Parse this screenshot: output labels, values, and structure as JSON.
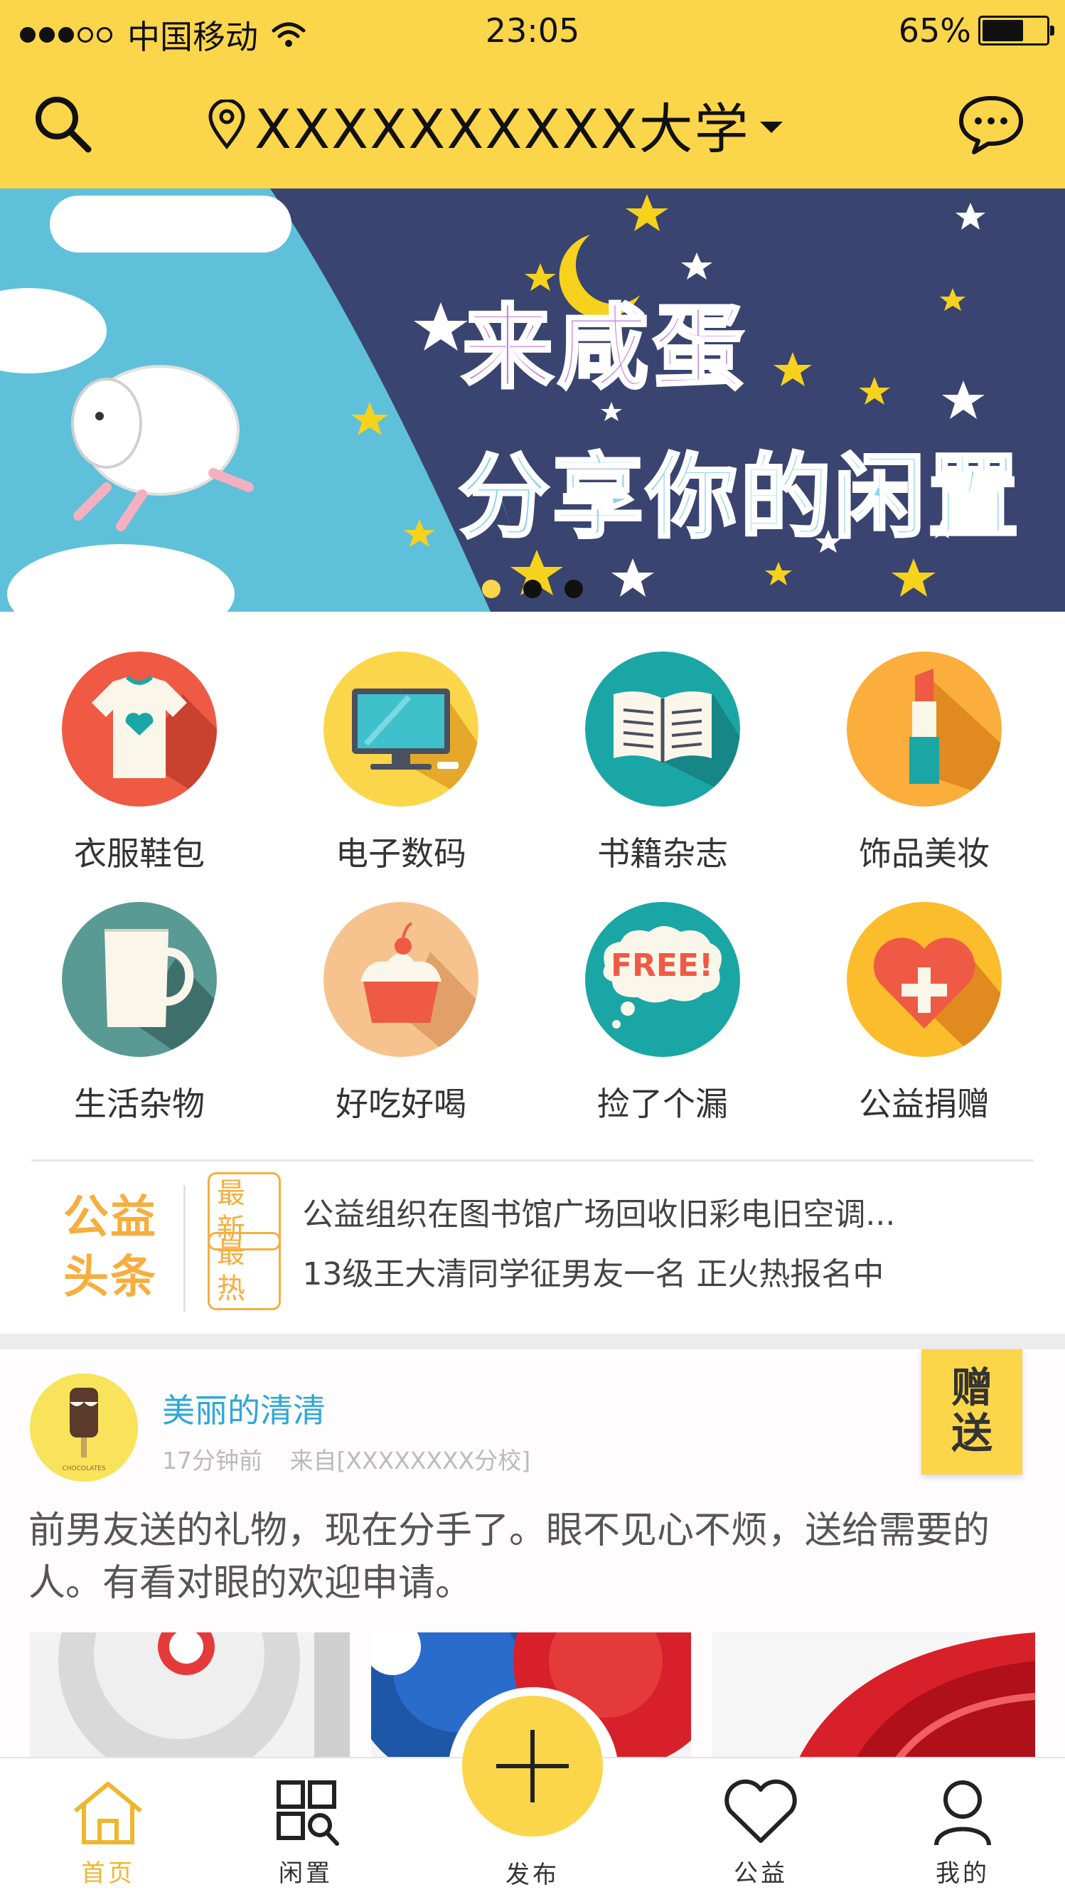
{
  "status_bar": {
    "carrier": "中国移动",
    "time": "23:05",
    "battery": "65%",
    "battery_level": 0.65,
    "signal_bars_filled": 3,
    "signal_bars_total": 5
  },
  "nav": {
    "location": "XXXXXXXXXX大学"
  },
  "banner": {
    "title": "来咸蛋",
    "subtitle": "分享你的闲置",
    "slide_count": 3,
    "active_slide": 1
  },
  "categories": [
    {
      "label": "衣服鞋包",
      "icon": "tshirt-icon",
      "color": "#ef5a45"
    },
    {
      "label": "电子数码",
      "icon": "computer-icon",
      "color": "#fcd64a"
    },
    {
      "label": "书籍杂志",
      "icon": "book-icon",
      "color": "#1ba6a6"
    },
    {
      "label": "饰品美妆",
      "icon": "lipstick-icon",
      "color": "#fbae3c"
    },
    {
      "label": "生活杂物",
      "icon": "mug-icon",
      "color": "#5a9a94"
    },
    {
      "label": "好吃好喝",
      "icon": "cupcake-icon",
      "color": "#f6c38f"
    },
    {
      "label": "捡了个漏",
      "icon": "free-icon",
      "color": "#1ba6a6"
    },
    {
      "label": "公益捐赠",
      "icon": "heart-plus-icon",
      "color": "#fbbd2c"
    }
  ],
  "headlines": {
    "logo": "公益头条",
    "items": [
      {
        "tag": "最新",
        "text": "公益组织在图书馆广场回收旧彩电旧空调..."
      },
      {
        "tag": "最热",
        "text": "13级王大清同学征男友一名 正火热报名中"
      }
    ]
  },
  "post": {
    "username": "美丽的清清",
    "time_ago": "17分钟前",
    "source": "来自[XXXXXXXX分校]",
    "badge": "赠送",
    "text": "前男友送的礼物，现在分手了。眼不见心不烦，送给需要的人。有看对眼的欢迎申请。",
    "avatar_text": "CHOCOLATES"
  },
  "tabbar": {
    "items": [
      {
        "label": "首页",
        "icon": "home-icon",
        "active": true
      },
      {
        "label": "闲置",
        "icon": "grid-search-icon",
        "active": false
      },
      {
        "label": "发布",
        "icon": "plus-icon",
        "active": false
      },
      {
        "label": "公益",
        "icon": "heart-icon",
        "active": false
      },
      {
        "label": "我的",
        "icon": "user-icon",
        "active": false
      }
    ]
  },
  "colors": {
    "brand_yellow": "#fcd64a",
    "accent_orange": "#f6ae3f",
    "link_blue": "#2ea7d8",
    "active_tab": "#f0b62e"
  }
}
